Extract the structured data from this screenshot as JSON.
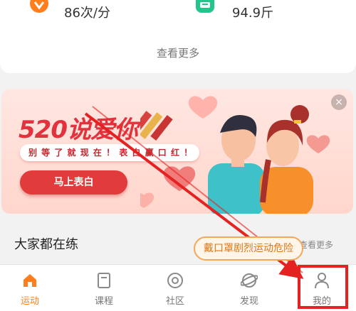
{
  "stats": {
    "heart_rate": "86次/分",
    "weight": "94.9斤",
    "more": "查看更多"
  },
  "banner": {
    "title": "520说爱你",
    "subtitle": "别 等 了 就 现 在 ！ 表 白 赢 口 红 ！",
    "button": "马上表白",
    "close": "×"
  },
  "section": {
    "title": "大家都在练",
    "more": "查看更多"
  },
  "tooltip": "戴口罩剧烈运动危险",
  "tabs": [
    {
      "label": "运动",
      "icon": "home-icon",
      "active": true
    },
    {
      "label": "课程",
      "icon": "course-icon",
      "active": false
    },
    {
      "label": "社区",
      "icon": "community-icon",
      "active": false
    },
    {
      "label": "发现",
      "icon": "discover-icon",
      "active": false
    },
    {
      "label": "我的",
      "icon": "profile-icon",
      "active": false
    }
  ],
  "colors": {
    "accent": "#ff7d1a",
    "annotation": "#e52222"
  }
}
